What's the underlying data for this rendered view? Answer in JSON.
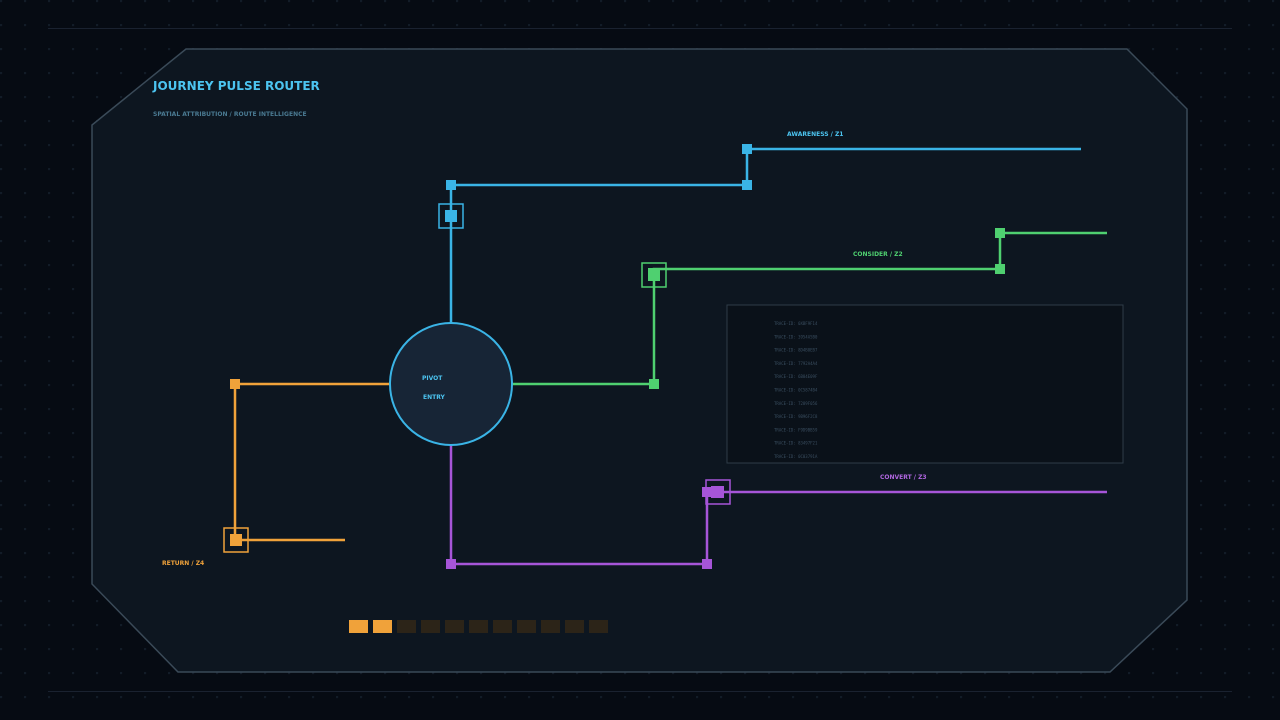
{
  "header": {
    "title": "JOURNEY PULSE ROUTER",
    "subtitle": "SPATIAL ATTRIBUTION / ROUTE INTELLIGENCE"
  },
  "hub": {
    "line1": "PIVOT",
    "line2": "ENTRY"
  },
  "routes": {
    "awareness": {
      "label": "AWARENESS / Z1",
      "color": "#3ab4e6"
    },
    "consider": {
      "label": "CONSIDER / Z2",
      "color": "#4fd070"
    },
    "convert": {
      "label": "CONVERT / Z3",
      "color": "#a655d8"
    },
    "return": {
      "label": "RETURN / Z4",
      "color": "#f0a23a"
    }
  },
  "trace_log": [
    "TRACE-ID: 0XBF9F14",
    "TRACE-ID: 3954A5B0",
    "TRACE-ID: 8D4B8EB7",
    "TRACE-ID: 7792A4A4",
    "TRACE-ID: 6B84E09F",
    "TRACE-ID: 0C5874B4",
    "TRACE-ID: 7289F056",
    "TRACE-ID: 9B96F2C8",
    "TRACE-ID: F9D9BB59",
    "TRACE-ID: 83497F21",
    "TRACE-ID: 0C03791A"
  ],
  "pulse_meter": {
    "active": 2,
    "total": 11,
    "active_color": "#f0a23a",
    "inactive_color": "#2c2418"
  },
  "colors": {
    "panel": "#0d1620",
    "panel_border": "#3a4a58",
    "hub_fill": "#172536",
    "title": "#4cc4f0",
    "subtitle": "#4a7a92",
    "trace_text": "#3a4e60"
  }
}
